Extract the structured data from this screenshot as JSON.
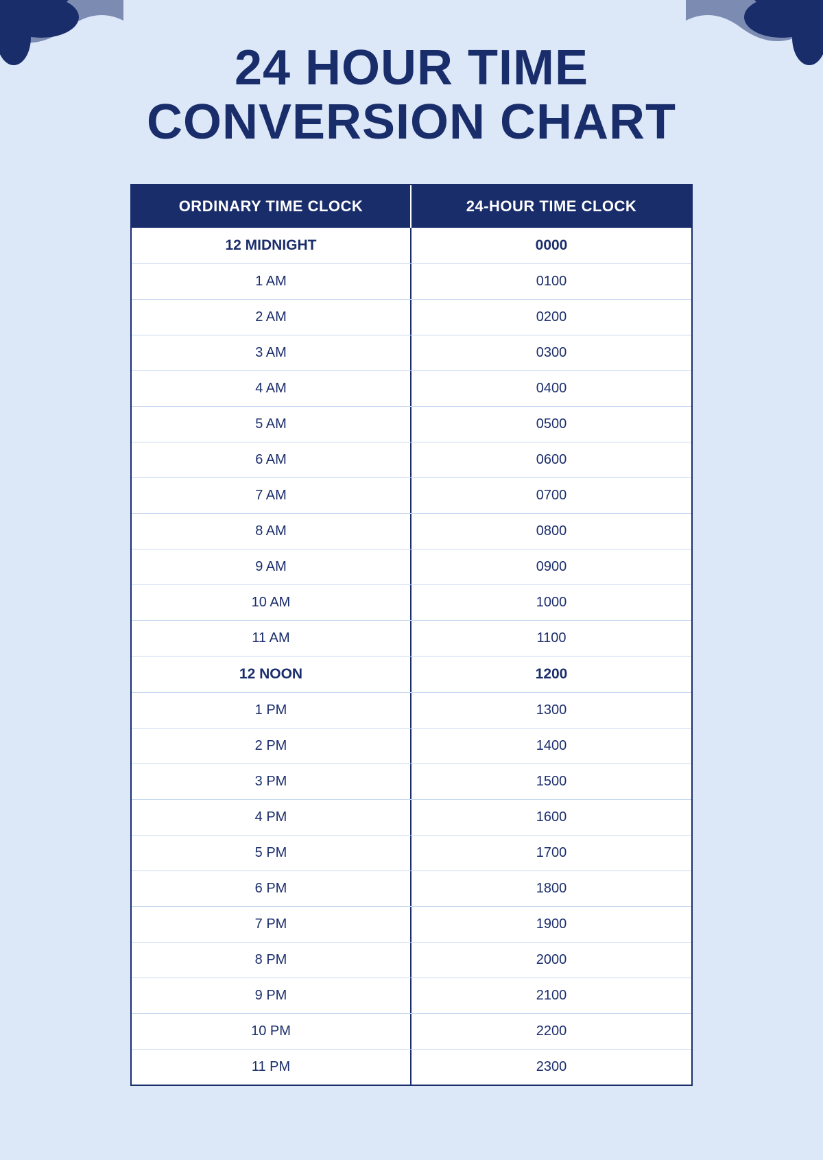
{
  "page": {
    "title_line1": "24 HOUR TIME",
    "title_line2": "CONVERSION CHART",
    "background_color": "#dce8f8",
    "accent_color": "#1a2d6b"
  },
  "table": {
    "header": {
      "col1": "ORDINARY TIME CLOCK",
      "col2": "24-HOUR TIME CLOCK"
    },
    "rows": [
      {
        "ordinary": "12 MIDNIGHT",
        "military": "0000",
        "bold": true
      },
      {
        "ordinary": "1 AM",
        "military": "0100",
        "bold": false
      },
      {
        "ordinary": "2 AM",
        "military": "0200",
        "bold": false
      },
      {
        "ordinary": "3 AM",
        "military": "0300",
        "bold": false
      },
      {
        "ordinary": "4 AM",
        "military": "0400",
        "bold": false
      },
      {
        "ordinary": "5 AM",
        "military": "0500",
        "bold": false
      },
      {
        "ordinary": "6 AM",
        "military": "0600",
        "bold": false
      },
      {
        "ordinary": "7 AM",
        "military": "0700",
        "bold": false
      },
      {
        "ordinary": "8 AM",
        "military": "0800",
        "bold": false
      },
      {
        "ordinary": "9 AM",
        "military": "0900",
        "bold": false
      },
      {
        "ordinary": "10 AM",
        "military": "1000",
        "bold": false
      },
      {
        "ordinary": "11 AM",
        "military": "1100",
        "bold": false
      },
      {
        "ordinary": "12 NOON",
        "military": "1200",
        "bold": true
      },
      {
        "ordinary": "1 PM",
        "military": "1300",
        "bold": false
      },
      {
        "ordinary": "2 PM",
        "military": "1400",
        "bold": false
      },
      {
        "ordinary": "3 PM",
        "military": "1500",
        "bold": false
      },
      {
        "ordinary": "4 PM",
        "military": "1600",
        "bold": false
      },
      {
        "ordinary": "5 PM",
        "military": "1700",
        "bold": false
      },
      {
        "ordinary": "6 PM",
        "military": "1800",
        "bold": false
      },
      {
        "ordinary": "7 PM",
        "military": "1900",
        "bold": false
      },
      {
        "ordinary": "8 PM",
        "military": "2000",
        "bold": false
      },
      {
        "ordinary": "9 PM",
        "military": "2100",
        "bold": false
      },
      {
        "ordinary": "10 PM",
        "military": "2200",
        "bold": false
      },
      {
        "ordinary": "11 PM",
        "military": "2300",
        "bold": false
      }
    ]
  }
}
